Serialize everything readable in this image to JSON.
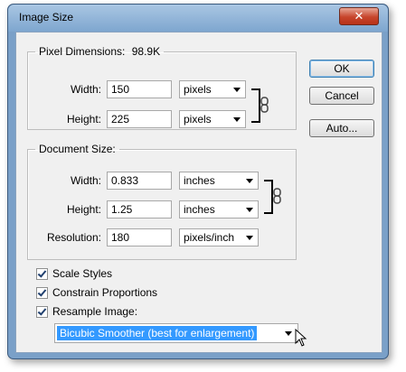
{
  "window": {
    "title": "Image Size",
    "close_glyph": "✕"
  },
  "pixel_dimensions": {
    "label": "Pixel Dimensions:",
    "size": "98.9K",
    "width": {
      "label": "Width:",
      "value": "150",
      "unit": "pixels"
    },
    "height": {
      "label": "Height:",
      "value": "225",
      "unit": "pixels"
    }
  },
  "document_size": {
    "label": "Document Size:",
    "width": {
      "label": "Width:",
      "value": "0.833",
      "unit": "inches"
    },
    "height": {
      "label": "Height:",
      "value": "1.25",
      "unit": "inches"
    },
    "resolution": {
      "label": "Resolution:",
      "value": "180",
      "unit": "pixels/inch"
    }
  },
  "options": {
    "scale_styles": {
      "label": "Scale Styles",
      "checked": true
    },
    "constrain_proportions": {
      "label": "Constrain Proportions",
      "checked": true
    },
    "resample_image": {
      "label": "Resample Image:",
      "checked": true
    }
  },
  "resample_method": {
    "selected": "Bicubic Smoother (best for enlargement)"
  },
  "buttons": {
    "ok": "OK",
    "cancel": "Cancel",
    "auto": "Auto..."
  },
  "icons": {
    "link": "chain-link-icon",
    "cursor": "mouse-pointer-icon",
    "dropdown": "chevron-down-icon"
  },
  "colors": {
    "selection": "#3399ff",
    "titlebar": "#7ea6cf",
    "close_button": "#c7452c"
  }
}
